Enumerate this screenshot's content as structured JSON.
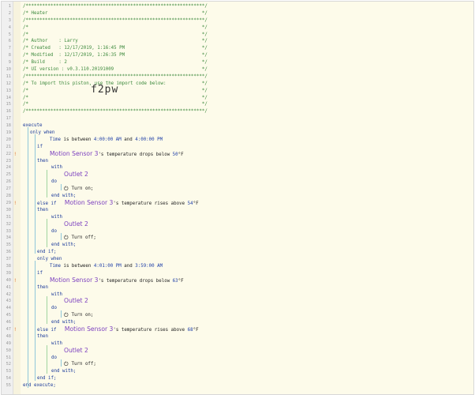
{
  "lines": [
    {
      "n": "1",
      "t": "/*****************************************************************/",
      "c": "cm",
      "x": 27
    },
    {
      "n": "2",
      "t": "/* Heater                                                        */",
      "c": "cm",
      "x": 27
    },
    {
      "n": "3",
      "t": "/*****************************************************************/",
      "c": "cm",
      "x": 27
    },
    {
      "n": "4",
      "t": "/*                                                               */",
      "c": "cm",
      "x": 27
    },
    {
      "n": "5",
      "t": "/*                                                               */",
      "c": "cm",
      "x": 27
    },
    {
      "n": "6",
      "t": "/* Author    : Larry                                             */",
      "c": "cm",
      "x": 27
    },
    {
      "n": "7",
      "t": "/* Created   : 12/17/2019, 1:16:45 PM                            */",
      "c": "cm",
      "x": 27
    },
    {
      "n": "8",
      "t": "/* Modified  : 12/17/2019, 1:26:35 PM                            */",
      "c": "cm",
      "x": 27
    },
    {
      "n": "9",
      "t": "/* Build     : 2                                                 */",
      "c": "cm",
      "x": 27
    },
    {
      "n": "10",
      "t": "/* UI version : v0.3.110.20191009                                */",
      "c": "cm",
      "x": 27
    },
    {
      "n": "11",
      "t": "/*****************************************************************/",
      "c": "cm",
      "x": 27
    },
    {
      "n": "12",
      "t": "/* To import this piston, use the import code below:             */",
      "c": "cm",
      "x": 27
    },
    {
      "n": "13",
      "t": "/*                                                               */",
      "c": "cm",
      "x": 27,
      "big": "f2pw"
    },
    {
      "n": "14",
      "t": "/*                                                               */",
      "c": "cm",
      "x": 27
    },
    {
      "n": "15",
      "t": "/*                                                               */",
      "c": "cm",
      "x": 27
    },
    {
      "n": "16",
      "t": "/*****************************************************************/",
      "c": "cm",
      "x": 27
    },
    {
      "n": "17",
      "t": "",
      "c": "pl",
      "x": 27
    },
    {
      "n": "18",
      "parts": [
        {
          "t": "execute",
          "c": "kw"
        }
      ],
      "x": 27
    },
    {
      "n": "19",
      "parts": [
        {
          "t": "only when",
          "c": "kw"
        }
      ],
      "x": 36
    },
    {
      "n": "20",
      "parts": [
        {
          "t": "Time",
          "c": "kw"
        },
        {
          "t": " is between ",
          "c": "pl"
        },
        {
          "t": "4:00:00 AM",
          "c": "num"
        },
        {
          "t": " and ",
          "c": "pl"
        },
        {
          "t": "4:00:00 PM",
          "c": "num"
        }
      ],
      "x": 61
    },
    {
      "n": "21",
      "parts": [
        {
          "t": "if",
          "c": "kw"
        }
      ],
      "x": 45
    },
    {
      "n": "22",
      "w": true,
      "parts": [
        {
          "t": "Motion Sensor 3",
          "c": "var"
        },
        {
          "t": "'s temperature drops below ",
          "c": "pl"
        },
        {
          "t": "50",
          "c": "num"
        },
        {
          "t": "°F",
          "c": "pl"
        }
      ],
      "x": 61
    },
    {
      "n": "23",
      "parts": [
        {
          "t": "then",
          "c": "kw"
        }
      ],
      "x": 45
    },
    {
      "n": "24",
      "parts": [
        {
          "t": "with",
          "c": "kw"
        }
      ],
      "x": 63
    },
    {
      "n": "25",
      "parts": [
        {
          "t": "Outlet 2",
          "c": "var"
        }
      ],
      "x": 79
    },
    {
      "n": "26",
      "parts": [
        {
          "t": "do",
          "c": "kw"
        }
      ],
      "x": 63
    },
    {
      "n": "27",
      "pwr": true,
      "parts": [
        {
          "t": " Turn on;",
          "c": "pl"
        }
      ],
      "x": 79
    },
    {
      "n": "28",
      "parts": [
        {
          "t": "end with;",
          "c": "kw"
        }
      ],
      "x": 63
    },
    {
      "n": "29",
      "w": true,
      "parts": [
        {
          "t": "else if",
          "c": "kw"
        },
        {
          "t": "   ",
          "c": "pl"
        },
        {
          "t": "Motion Sensor 3",
          "c": "var"
        },
        {
          "t": "'s temperature rises above ",
          "c": "pl"
        },
        {
          "t": "54",
          "c": "num"
        },
        {
          "t": "°F",
          "c": "pl"
        }
      ],
      "x": 45
    },
    {
      "n": "30",
      "parts": [
        {
          "t": "then",
          "c": "kw"
        }
      ],
      "x": 45
    },
    {
      "n": "31",
      "parts": [
        {
          "t": "with",
          "c": "kw"
        }
      ],
      "x": 63
    },
    {
      "n": "32",
      "parts": [
        {
          "t": "Outlet 2",
          "c": "var"
        }
      ],
      "x": 79
    },
    {
      "n": "33",
      "parts": [
        {
          "t": "do",
          "c": "kw"
        }
      ],
      "x": 63
    },
    {
      "n": "34",
      "pwr": true,
      "parts": [
        {
          "t": " Turn off;",
          "c": "pl"
        }
      ],
      "x": 79
    },
    {
      "n": "35",
      "parts": [
        {
          "t": "end with;",
          "c": "kw"
        }
      ],
      "x": 63
    },
    {
      "n": "36",
      "parts": [
        {
          "t": "end if;",
          "c": "kw"
        }
      ],
      "x": 45
    },
    {
      "n": "37",
      "parts": [
        {
          "t": "only when",
          "c": "kw"
        }
      ],
      "x": 45
    },
    {
      "n": "38",
      "parts": [
        {
          "t": "Time",
          "c": "kw"
        },
        {
          "t": " is between ",
          "c": "pl"
        },
        {
          "t": "4:01:00 PM",
          "c": "num"
        },
        {
          "t": " and ",
          "c": "pl"
        },
        {
          "t": "3:59:00 AM",
          "c": "num"
        }
      ],
      "x": 61
    },
    {
      "n": "39",
      "parts": [
        {
          "t": "if",
          "c": "kw"
        }
      ],
      "x": 45
    },
    {
      "n": "40",
      "w": true,
      "parts": [
        {
          "t": "Motion Sensor 3",
          "c": "var"
        },
        {
          "t": "'s temperature drops below ",
          "c": "pl"
        },
        {
          "t": "63",
          "c": "num"
        },
        {
          "t": "°F",
          "c": "pl"
        }
      ],
      "x": 61
    },
    {
      "n": "41",
      "parts": [
        {
          "t": "then",
          "c": "kw"
        }
      ],
      "x": 45
    },
    {
      "n": "42",
      "parts": [
        {
          "t": "with",
          "c": "kw"
        }
      ],
      "x": 63
    },
    {
      "n": "43",
      "parts": [
        {
          "t": "Outlet 2",
          "c": "var"
        }
      ],
      "x": 79
    },
    {
      "n": "44",
      "parts": [
        {
          "t": "do",
          "c": "kw"
        }
      ],
      "x": 63
    },
    {
      "n": "45",
      "pwr": true,
      "parts": [
        {
          "t": " Turn on;",
          "c": "pl"
        }
      ],
      "x": 79
    },
    {
      "n": "46",
      "parts": [
        {
          "t": "end with;",
          "c": "kw"
        }
      ],
      "x": 63
    },
    {
      "n": "47",
      "w": true,
      "parts": [
        {
          "t": "else if",
          "c": "kw"
        },
        {
          "t": "   ",
          "c": "pl"
        },
        {
          "t": "Motion Sensor 3",
          "c": "var"
        },
        {
          "t": "'s temperature rises above ",
          "c": "pl"
        },
        {
          "t": "68",
          "c": "num"
        },
        {
          "t": "°F",
          "c": "pl"
        }
      ],
      "x": 45
    },
    {
      "n": "48",
      "parts": [
        {
          "t": "then",
          "c": "kw"
        }
      ],
      "x": 45
    },
    {
      "n": "49",
      "parts": [
        {
          "t": "with",
          "c": "kw"
        }
      ],
      "x": 63
    },
    {
      "n": "50",
      "parts": [
        {
          "t": "Outlet 2",
          "c": "var"
        }
      ],
      "x": 79
    },
    {
      "n": "51",
      "parts": [
        {
          "t": "do",
          "c": "kw"
        }
      ],
      "x": 63
    },
    {
      "n": "52",
      "pwr": true,
      "parts": [
        {
          "t": " Turn off;",
          "c": "pl"
        }
      ],
      "x": 79
    },
    {
      "n": "53",
      "parts": [
        {
          "t": "end with;",
          "c": "kw"
        }
      ],
      "x": 63
    },
    {
      "n": "54",
      "parts": [
        {
          "t": "end if;",
          "c": "kw"
        }
      ],
      "x": 45
    },
    {
      "n": "55",
      "parts": [
        {
          "t": "end execute;",
          "c": "kw"
        }
      ],
      "x": 27
    }
  ],
  "warning_glyph": "!",
  "power_glyph": "⏻"
}
